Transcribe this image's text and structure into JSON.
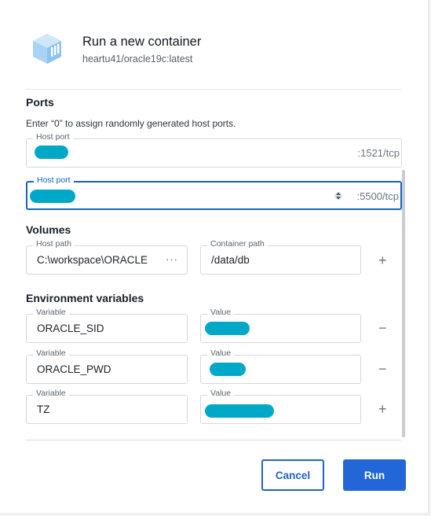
{
  "header": {
    "title": "Run a new container",
    "image": "heartu41/oracle19c:latest",
    "icon": "container-icon"
  },
  "ports": {
    "title": "Ports",
    "hint": "Enter “0” to assign randomly generated host ports.",
    "rows": [
      {
        "label": "Host port",
        "suffix": ":1521/tcp"
      },
      {
        "label": "Host port",
        "suffix": ":5500/tcp"
      }
    ]
  },
  "volumes": {
    "title": "Volumes",
    "host_label": "Host path",
    "host_value": "C:\\workspace\\ORACLE",
    "container_label": "Container path",
    "container_value": "/data/db",
    "more_label": "···"
  },
  "env": {
    "title": "Environment variables",
    "rows": [
      {
        "var_label": "Variable",
        "var_value": "ORACLE_SID",
        "val_label": "Value",
        "action": "−"
      },
      {
        "var_label": "Variable",
        "var_value": "ORACLE_PWD",
        "val_label": "Value",
        "action": "−"
      },
      {
        "var_label": "Variable",
        "var_value": "TZ",
        "val_label": "Value",
        "action": "+"
      }
    ],
    "add_volume_action": "+"
  },
  "buttons": {
    "cancel": "Cancel",
    "run": "Run"
  },
  "colors": {
    "accent": "#1f63c5",
    "primary": "#2266d7",
    "redaction": "#00a8c8"
  }
}
